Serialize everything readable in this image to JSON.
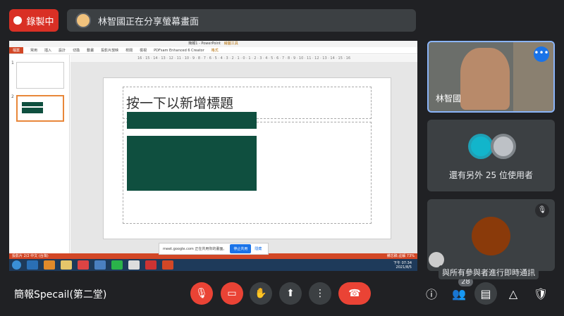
{
  "recording": {
    "label": "錄製中",
    "color": "#d93025"
  },
  "presenter_banner": "林智國正在分享螢幕畫面",
  "shared_screen": {
    "app_title": "簡報1 - PowerPoint",
    "contextual_tab": "繪圖工具",
    "ribbon_tabs": [
      "檔案",
      "常用",
      "插入",
      "設計",
      "切換",
      "動畫",
      "投影片放映",
      "校閱",
      "檢視",
      "PDFsam Enhanced 6 Creator",
      "格式"
    ],
    "ruler": "16 · 15 · 14 · 13 · 12 · 11 · 10 · 9 · 8 · 7 · 6 · 5 · 4 · 3 · 2 · 1 · 0 · 1 · 2 · 3 · 4 · 5 · 6 · 7 · 8 · 9 · 10 · 11 · 12 · 13 · 14 · 15 · 16",
    "slide_numbers": [
      "1",
      "2"
    ],
    "slide_title_placeholder": "按一下以新增標題",
    "status_left": "投影片 2/2   中文 (台灣)",
    "status_right": "備忘稿  註解   73%",
    "share_notice": {
      "text": "meet.google.com 正在共用你的畫面。",
      "stop": "停止共用",
      "hide": "隱藏"
    },
    "clock": {
      "time": "下午 07:34",
      "date": "2021/8/5"
    }
  },
  "tiles": {
    "presenter_name": "林智國",
    "others_text": "還有另外 25 位使用者"
  },
  "meeting_name": "簡報Specail(第二堂)",
  "participants_count": "28",
  "tooltip": "與所有參與者進行即時通訊",
  "colors": {
    "end_call": "#ea4335",
    "muted_button": "#ea4335",
    "bar_bg": "#202124"
  }
}
